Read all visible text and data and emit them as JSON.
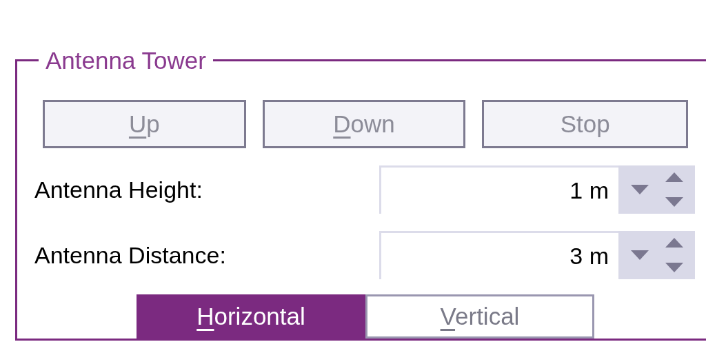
{
  "group": {
    "title": "Antenna Tower"
  },
  "buttons": [
    {
      "key": "U",
      "text": "p",
      "disabled": true
    },
    {
      "key": "D",
      "text": "own",
      "disabled": true
    },
    {
      "text": "Stop",
      "disabled": true
    }
  ],
  "fields": [
    {
      "label": "Antenna Height:",
      "value": "1 m"
    },
    {
      "label": "Antenna Distance:",
      "value": "3 m"
    }
  ],
  "tabs": [
    {
      "key": "H",
      "text": "orizontal",
      "selected": true
    },
    {
      "key": "V",
      "text": "ertical",
      "selected": false
    }
  ]
}
